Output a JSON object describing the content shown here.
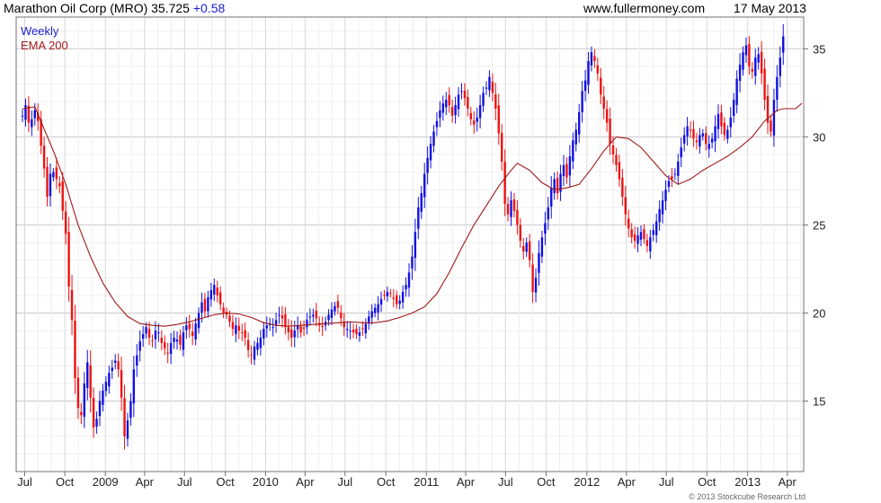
{
  "header": {
    "title": "Marathon Oil Corp (MRO) 35.725",
    "change": "+0.58",
    "site": "www.fullermoney.com",
    "date": "17 May 2013"
  },
  "copyright": "© 2013 Stockcube Research Ltd",
  "chart_data": {
    "type": "candlestick",
    "legend": [
      {
        "name": "Weekly",
        "color": "#1a1acc"
      },
      {
        "name": "EMA 200",
        "color": "#a01818"
      }
    ],
    "colors": {
      "up": "#1010e0",
      "down": "#ee1111",
      "ema": "#a01818",
      "grid": "#d8d8d8"
    },
    "y_ticks": [
      15,
      20,
      25,
      30,
      35
    ],
    "ylim": [
      11.0,
      36.8
    ],
    "x_ticks": [
      {
        "label": "Jul",
        "t": 0.72
      },
      {
        "label": "Oct",
        "t": 13.7
      },
      {
        "label": "2009",
        "t": 26.8
      },
      {
        "label": "Apr",
        "t": 39.5
      },
      {
        "label": "Jul",
        "t": 52.4
      },
      {
        "label": "Oct",
        "t": 65.6
      },
      {
        "label": "2010",
        "t": 78.6
      },
      {
        "label": "Apr",
        "t": 91.4
      },
      {
        "label": "Jul",
        "t": 104.3
      },
      {
        "label": "Oct",
        "t": 117.5
      },
      {
        "label": "2011",
        "t": 130.6
      },
      {
        "label": "Apr",
        "t": 143.3
      },
      {
        "label": "Jul",
        "t": 156.2
      },
      {
        "label": "Oct",
        "t": 169.3
      },
      {
        "label": "2012",
        "t": 182.5
      },
      {
        "label": "Apr",
        "t": 195.3
      },
      {
        "label": "Jul",
        "t": 208.2
      },
      {
        "label": "Oct",
        "t": 221.3
      },
      {
        "label": "2013",
        "t": 234.5
      },
      {
        "label": "Apr",
        "t": 247.3
      }
    ],
    "weekly_close": [
      31.2,
      31.8,
      30.8,
      31.0,
      31.5,
      30.9,
      29.5,
      28.2,
      26.6,
      27.9,
      28.0,
      27.6,
      27.2,
      25.8,
      24.5,
      21.5,
      19.6,
      16.3,
      14.6,
      14.2,
      16.0,
      17.2,
      15.2,
      13.5,
      14.0,
      15.0,
      15.6,
      16.1,
      16.6,
      16.9,
      17.3,
      16.8,
      15.2,
      13.0,
      13.9,
      15.0,
      16.8,
      17.6,
      18.4,
      18.8,
      19.2,
      18.6,
      18.4,
      19.0,
      18.9,
      18.3,
      18.0,
      17.7,
      18.3,
      18.6,
      18.5,
      18.2,
      18.9,
      19.3,
      19.1,
      18.7,
      19.4,
      20.0,
      20.6,
      20.1,
      20.9,
      21.3,
      21.6,
      21.0,
      20.5,
      20.0,
      19.9,
      19.5,
      19.1,
      19.3,
      19.0,
      18.9,
      18.6,
      17.9,
      17.6,
      18.1,
      18.3,
      18.6,
      19.1,
      19.3,
      19.4,
      19.2,
      19.6,
      19.9,
      19.7,
      19.2,
      18.9,
      18.6,
      19.0,
      19.3,
      18.9,
      19.1,
      19.6,
      19.8,
      19.9,
      19.7,
      19.3,
      19.2,
      19.5,
      19.9,
      20.2,
      20.4,
      20.3,
      19.7,
      19.2,
      19.1,
      19.0,
      18.9,
      18.8,
      18.9,
      19.1,
      19.4,
      19.8,
      20.1,
      20.3,
      20.5,
      20.8,
      21.0,
      21.2,
      21.1,
      20.8,
      20.5,
      20.7,
      21.2,
      21.6,
      22.3,
      23.2,
      24.6,
      26.0,
      26.8,
      27.9,
      28.8,
      29.6,
      30.3,
      30.9,
      31.5,
      31.9,
      32.1,
      31.8,
      31.2,
      31.8,
      32.4,
      32.6,
      32.2,
      31.6,
      31.0,
      30.7,
      31.1,
      31.8,
      32.5,
      32.8,
      33.4,
      32.5,
      31.6,
      30.2,
      28.6,
      26.2,
      25.6,
      26.4,
      25.8,
      25.0,
      24.1,
      23.5,
      24.0,
      23.0,
      21.2,
      22.0,
      23.4,
      24.3,
      25.1,
      26.0,
      27.1,
      27.6,
      26.8,
      27.9,
      28.4,
      27.7,
      28.9,
      29.8,
      30.4,
      31.4,
      32.6,
      33.2,
      34.3,
      34.8,
      34.3,
      33.6,
      32.4,
      31.6,
      30.8,
      29.6,
      29.0,
      28.4,
      27.6,
      26.6,
      25.6,
      24.8,
      24.3,
      24.1,
      24.4,
      24.6,
      24.2,
      23.8,
      24.3,
      24.7,
      25.2,
      25.9,
      26.4,
      27.0,
      27.5,
      27.6,
      27.9,
      28.6,
      29.4,
      30.1,
      30.6,
      30.4,
      29.9,
      29.7,
      30.1,
      30.2,
      29.6,
      29.6,
      29.9,
      30.6,
      31.3,
      30.6,
      30.1,
      30.4,
      31.1,
      32.1,
      33.3,
      34.1,
      34.8,
      35.2,
      34.0,
      33.7,
      34.5,
      34.7,
      33.6,
      32.1,
      30.8,
      30.3,
      32.1,
      33.4,
      34.5,
      35.7
    ],
    "ema200": [
      [
        0,
        31.6
      ],
      [
        4,
        31.7
      ],
      [
        10,
        29.2
      ],
      [
        14,
        27.3
      ],
      [
        18,
        25.0
      ],
      [
        22,
        23.2
      ],
      [
        26,
        21.7
      ],
      [
        30,
        20.6
      ],
      [
        34,
        19.8
      ],
      [
        38,
        19.4
      ],
      [
        42,
        19.3
      ],
      [
        46,
        19.25
      ],
      [
        50,
        19.35
      ],
      [
        54,
        19.5
      ],
      [
        58,
        19.7
      ],
      [
        62,
        19.9
      ],
      [
        66,
        20.0
      ],
      [
        70,
        19.95
      ],
      [
        74,
        19.75
      ],
      [
        78,
        19.45
      ],
      [
        82,
        19.3
      ],
      [
        86,
        19.25
      ],
      [
        90,
        19.3
      ],
      [
        94,
        19.35
      ],
      [
        98,
        19.4
      ],
      [
        102,
        19.45
      ],
      [
        106,
        19.5
      ],
      [
        110,
        19.45
      ],
      [
        114,
        19.45
      ],
      [
        118,
        19.55
      ],
      [
        122,
        19.75
      ],
      [
        126,
        20.0
      ],
      [
        130,
        20.35
      ],
      [
        134,
        21.1
      ],
      [
        138,
        22.3
      ],
      [
        142,
        23.7
      ],
      [
        146,
        25.0
      ],
      [
        150,
        26.1
      ],
      [
        154,
        27.2
      ],
      [
        158,
        28.1
      ],
      [
        160,
        28.5
      ],
      [
        164,
        28.1
      ],
      [
        168,
        27.4
      ],
      [
        172,
        27.0
      ],
      [
        176,
        27.1
      ],
      [
        180,
        27.3
      ],
      [
        184,
        28.2
      ],
      [
        188,
        29.2
      ],
      [
        192,
        30.0
      ],
      [
        196,
        29.9
      ],
      [
        200,
        29.4
      ],
      [
        204,
        28.6
      ],
      [
        208,
        27.8
      ],
      [
        212,
        27.3
      ],
      [
        216,
        27.6
      ],
      [
        220,
        28.1
      ],
      [
        224,
        28.5
      ],
      [
        228,
        28.9
      ],
      [
        232,
        29.4
      ],
      [
        236,
        30.0
      ],
      [
        240,
        30.9
      ],
      [
        244,
        31.5
      ],
      [
        246,
        31.6
      ],
      [
        248,
        31.6
      ],
      [
        250,
        31.6
      ],
      [
        252,
        31.9
      ]
    ]
  }
}
